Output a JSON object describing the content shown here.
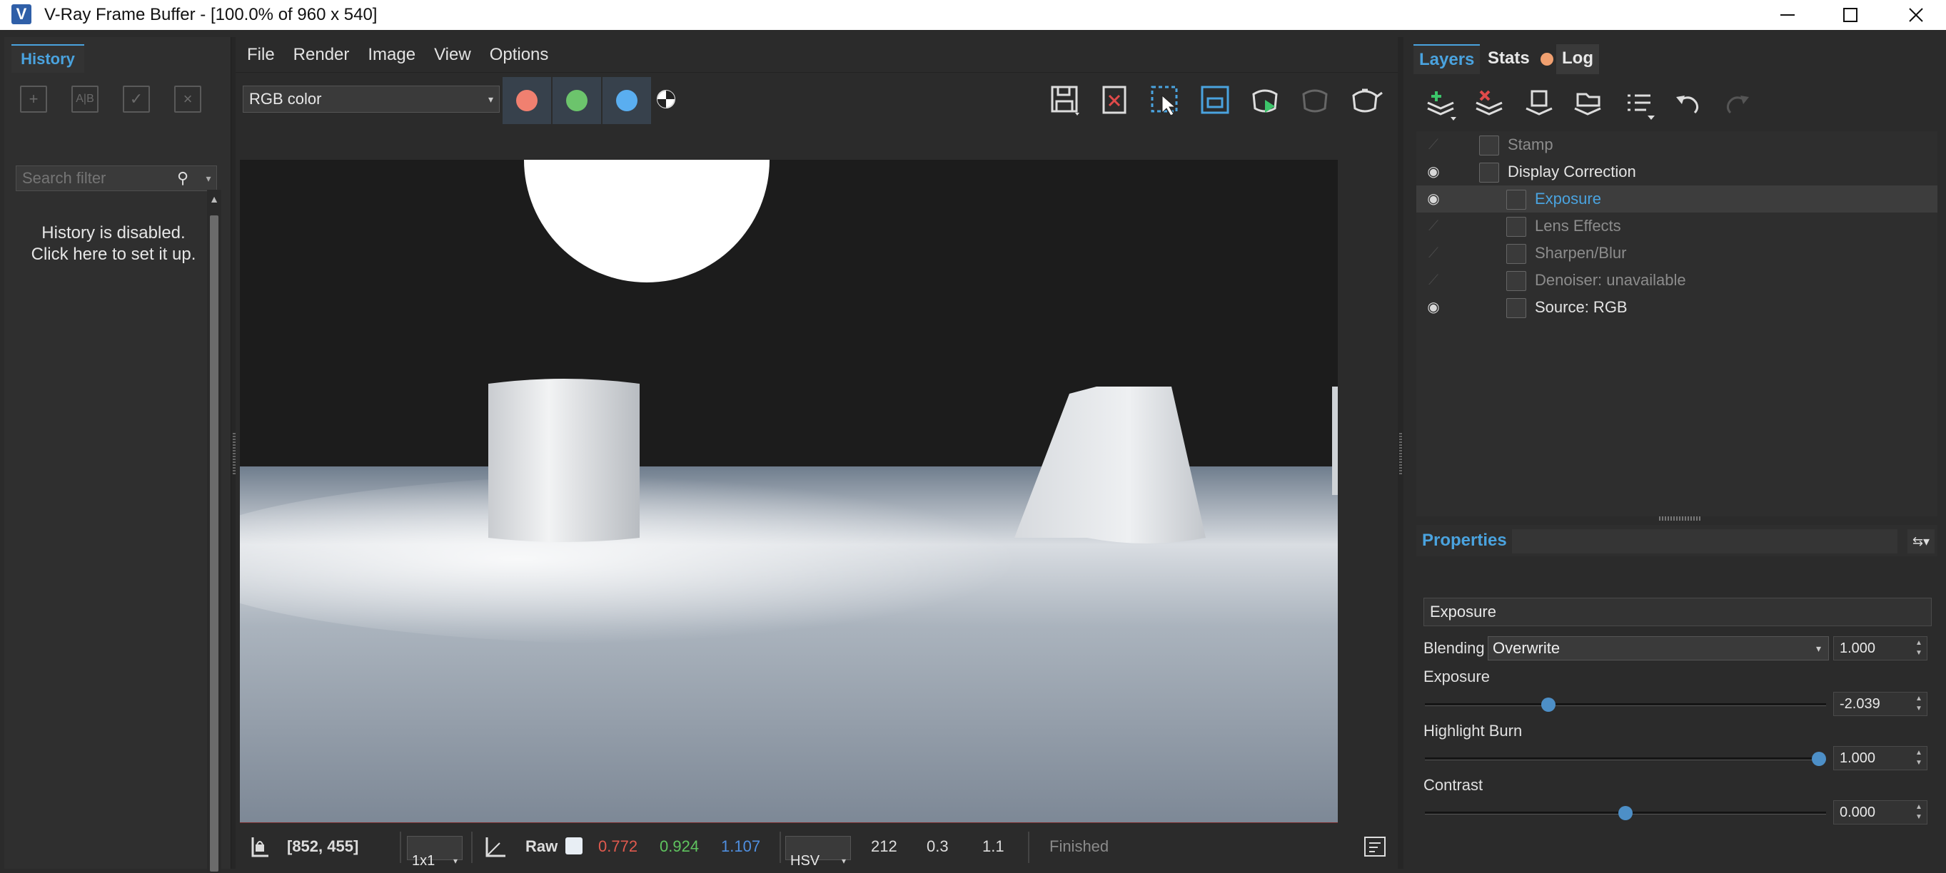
{
  "window": {
    "title": "V-Ray Frame Buffer - [100.0% of 960 x 540]",
    "app_icon": "V",
    "controls": [
      "minimize-icon",
      "maximize-icon",
      "close-icon"
    ]
  },
  "history": {
    "tab_label": "History",
    "search_placeholder": "Search filter",
    "message_line1": "History is disabled.",
    "message_line2": "Click here to set it up."
  },
  "menu": [
    "File",
    "Render",
    "Image",
    "View",
    "Options"
  ],
  "toolbar": {
    "channel_value": "RGB color",
    "channel_colors": [
      "#f08070",
      "#6cc46c",
      "#5aaef0"
    ]
  },
  "status": {
    "coords": "[852, 455]",
    "zoom": "1x1",
    "mode": "Raw",
    "r": "0.772",
    "g": "0.924",
    "b": "1.107",
    "colorspace": "HSV",
    "h": "212",
    "s": "0.3",
    "v": "1.1",
    "state": "Finished",
    "r_color": "#e05a4e",
    "g_color": "#5fc45f",
    "b_color": "#4f8fe0"
  },
  "right_tabs": {
    "layers": "Layers",
    "stats": "Stats",
    "log": "Log",
    "active_color": "#4aa3df"
  },
  "layers": [
    {
      "name": "Stamp",
      "visible": false,
      "indent": 0,
      "selected": false,
      "dim": true
    },
    {
      "name": "Display Correction",
      "visible": true,
      "indent": 0,
      "selected": false,
      "dim": false
    },
    {
      "name": "Exposure",
      "visible": true,
      "indent": 1,
      "selected": true,
      "dim": false
    },
    {
      "name": "Lens Effects",
      "visible": false,
      "indent": 1,
      "selected": false,
      "dim": true
    },
    {
      "name": "Sharpen/Blur",
      "visible": false,
      "indent": 1,
      "selected": false,
      "dim": true
    },
    {
      "name": "Denoiser: unavailable",
      "visible": false,
      "indent": 1,
      "selected": false,
      "dim": true
    },
    {
      "name": "Source: RGB",
      "visible": true,
      "indent": 1,
      "selected": false,
      "dim": false
    }
  ],
  "properties": {
    "header": "Properties",
    "name": "Exposure",
    "blending_label": "Blending",
    "blending_value": "Overwrite",
    "blending_amount": "1.000",
    "exposure_label": "Exposure",
    "exposure_value": "-2.039",
    "exposure_level": 0.3,
    "highlight_label": "Highlight Burn",
    "highlight_value": "1.000",
    "highlight_level": 1.0,
    "contrast_label": "Contrast",
    "contrast_value": "0.000",
    "contrast_level": 0.5
  }
}
